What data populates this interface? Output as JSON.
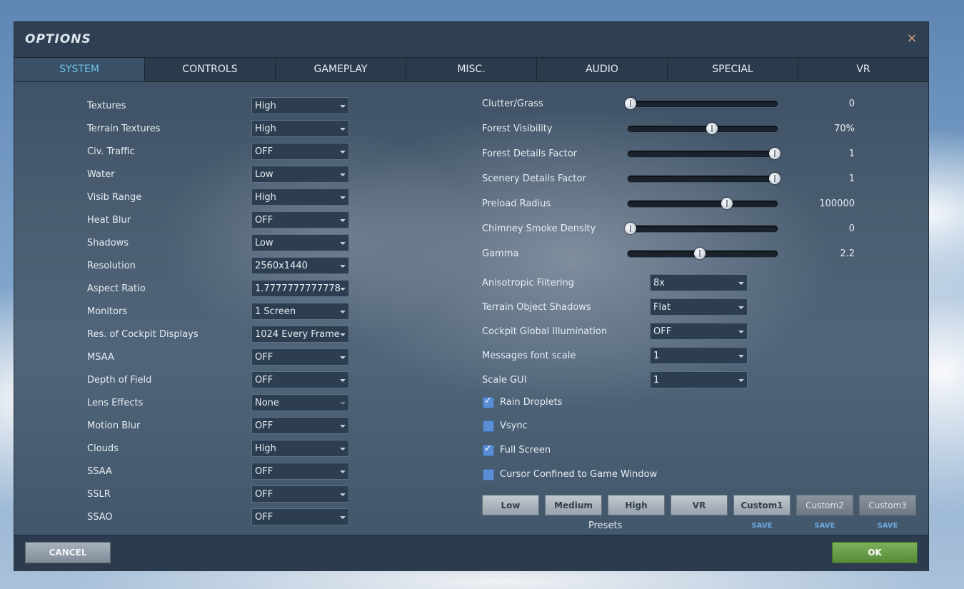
{
  "window": {
    "title": "OPTIONS",
    "close_icon": "×"
  },
  "tabs": [
    "SYSTEM",
    "CONTROLS",
    "GAMEPLAY",
    "MISC.",
    "AUDIO",
    "SPECIAL",
    "VR"
  ],
  "active_tab": "SYSTEM",
  "left_settings": [
    {
      "label": "Textures",
      "value": "High"
    },
    {
      "label": "Terrain Textures",
      "value": "High"
    },
    {
      "label": "Civ. Traffic",
      "value": "OFF"
    },
    {
      "label": "Water",
      "value": "Low"
    },
    {
      "label": "Visib Range",
      "value": "High"
    },
    {
      "label": "Heat Blur",
      "value": "OFF"
    },
    {
      "label": "Shadows",
      "value": "Low"
    },
    {
      "label": "Resolution",
      "value": "2560x1440"
    },
    {
      "label": "Aspect Ratio",
      "value": "1.7777777777778"
    },
    {
      "label": "Monitors",
      "value": "1 Screen"
    },
    {
      "label": "Res. of Cockpit Displays",
      "value": "1024 Every Frame"
    },
    {
      "label": "MSAA",
      "value": "OFF"
    },
    {
      "label": "Depth of Field",
      "value": "OFF"
    },
    {
      "label": "Lens Effects",
      "value": "None",
      "disabled": true
    },
    {
      "label": "Motion Blur",
      "value": "OFF"
    },
    {
      "label": "Clouds",
      "value": "High"
    },
    {
      "label": "SSAA",
      "value": "OFF"
    },
    {
      "label": "SSLR",
      "value": "OFF"
    },
    {
      "label": "SSAO",
      "value": "OFF"
    }
  ],
  "sliders": [
    {
      "label": "Clutter/Grass",
      "value": "0",
      "level": 0.02
    },
    {
      "label": "Forest Visibility",
      "value": "70%",
      "level": 0.56
    },
    {
      "label": "Forest Details Factor",
      "value": "1",
      "level": 0.98
    },
    {
      "label": "Scenery Details Factor",
      "value": "1",
      "level": 0.98
    },
    {
      "label": "Preload Radius",
      "value": "100000",
      "level": 0.66
    },
    {
      "label": "Chimney Smoke Density",
      "value": "0",
      "level": 0.02
    },
    {
      "label": "Gamma",
      "value": "2.2",
      "level": 0.48
    }
  ],
  "right_settings": [
    {
      "label": "Anisotropic Filtering",
      "value": "8x"
    },
    {
      "label": "Terrain Object Shadows",
      "value": "Flat"
    },
    {
      "label": "Cockpit Global Illumination",
      "value": "OFF"
    },
    {
      "label": "Messages font scale",
      "value": "1"
    },
    {
      "label": "Scale GUI",
      "value": "1"
    }
  ],
  "checkboxes": [
    {
      "label": "Rain Droplets",
      "checked": true
    },
    {
      "label": "Vsync",
      "checked": false
    },
    {
      "label": "Full Screen",
      "checked": true
    },
    {
      "label": "Cursor Confined to Game Window",
      "checked": false
    }
  ],
  "presets": {
    "buttons": [
      "Low",
      "Medium",
      "High",
      "VR",
      "Custom1",
      "Custom2",
      "Custom3"
    ],
    "label": "Presets",
    "save_label": "SAVE"
  },
  "footer": {
    "cancel_label": "CANCEL",
    "ok_label": "OK"
  },
  "colors": {
    "active_tab_text": "#6ec3ea",
    "ok_button": "#6a9e48",
    "checkbox": "#5b8fd4"
  }
}
